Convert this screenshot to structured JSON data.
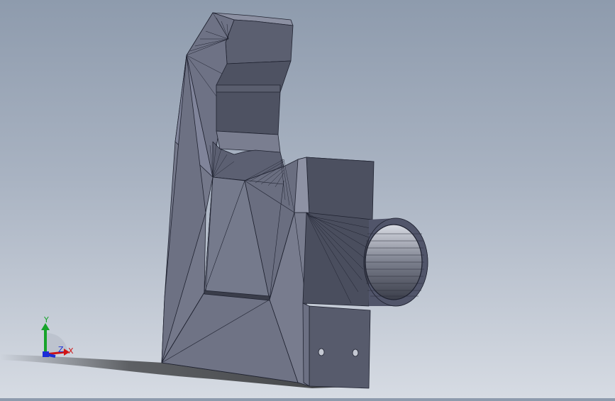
{
  "viewport": {
    "background_top": "#8e9bad",
    "background_bottom": "#d6dbe3",
    "model_color": "#6b6f80",
    "edge_color": "#1f2230"
  },
  "triad": {
    "x_label": "X",
    "y_label": "Y",
    "z_label": "Z",
    "x_color": "#d11414",
    "y_color": "#16a32a",
    "z_color": "#1c2ed6"
  },
  "model": {
    "icon": "3d-part-icon"
  }
}
